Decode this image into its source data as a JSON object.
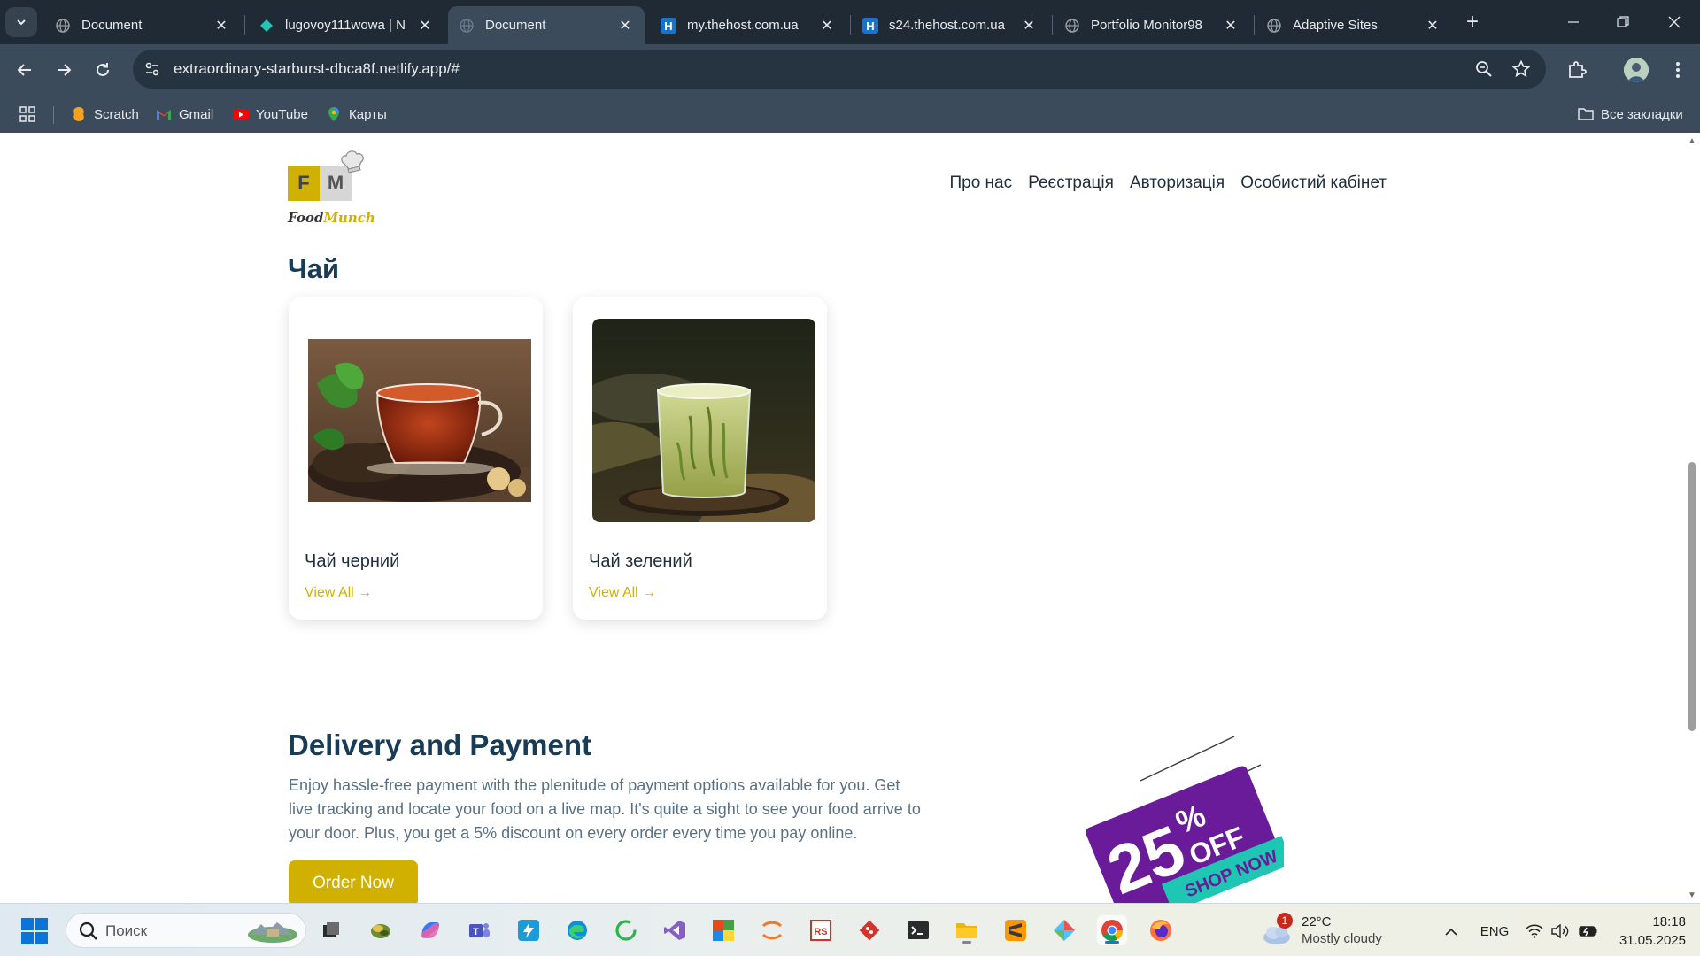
{
  "browser": {
    "tabs": [
      {
        "title": "Document",
        "favicon": "globe-icon",
        "active": false
      },
      {
        "title": "lugovoy111wowa | N",
        "favicon": "netlify-icon",
        "active": false
      },
      {
        "title": "Document",
        "favicon": "globe-icon",
        "active": true
      },
      {
        "title": "my.thehost.com.ua",
        "favicon": "thehost-icon",
        "active": false
      },
      {
        "title": "s24.thehost.com.ua",
        "favicon": "thehost-icon",
        "active": false
      },
      {
        "title": "Portfolio Monitor98",
        "favicon": "globe-icon",
        "active": false
      },
      {
        "title": "Adaptive Sites",
        "favicon": "globe-icon",
        "active": false
      }
    ],
    "url": "extraordinary-starburst-dbca8f.netlify.app/#",
    "bookmarks": [
      {
        "label": "Scratch",
        "icon": "scratch-icon"
      },
      {
        "label": "Gmail",
        "icon": "gmail-icon"
      },
      {
        "label": "YouTube",
        "icon": "youtube-icon"
      },
      {
        "label": "Карты",
        "icon": "maps-icon"
      }
    ],
    "all_bookmarks_label": "Все закладки"
  },
  "site": {
    "logo": {
      "food": "Food",
      "munch": "Munch",
      "letter_f": "F",
      "letter_m": "M"
    },
    "nav": [
      "Про нас",
      "Реєстрація",
      "Авторизація",
      "Особистий кабінет"
    ],
    "tea_section": {
      "title": "Чай",
      "items": [
        {
          "name": "Чай черний",
          "link": "View All →"
        },
        {
          "name": "Чай зелений",
          "link": "View All →"
        }
      ]
    },
    "delivery": {
      "title": "Delivery and Payment",
      "text": "Enjoy hassle-free payment with the plenitude of payment options available for you. Get live tracking and locate your food on a live map. It's quite a sight to see your food arrive to your door. Plus, you get a 5% discount on every order every time you pay online.",
      "button": "Order Now"
    },
    "promo": {
      "percent": "25",
      "sign": "%",
      "off": "OFF",
      "shop": "SHOP NOW"
    }
  },
  "taskbar": {
    "search_placeholder": "Поиск",
    "weather": {
      "badge": "1",
      "temp": "22°C",
      "desc": "Mostly cloudy"
    },
    "language": "ENG",
    "time": "18:18",
    "date": "31.05.2025"
  },
  "colors": {
    "brand_yellow": "#d0b000",
    "heading_navy": "#183b56",
    "body_text": "#5a7184",
    "promo_purple": "#6a1b9a",
    "promo_teal": "#1fc6b3"
  }
}
